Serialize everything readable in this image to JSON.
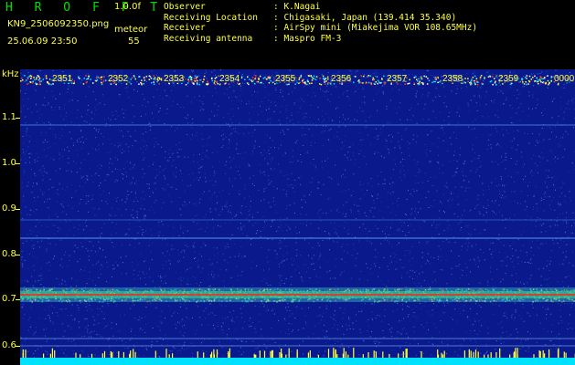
{
  "header": {
    "app_title": "H R O F F T",
    "version": "1.0.0f",
    "filename": "KN9_2506092350.png",
    "meteor_label": "meteor",
    "datetime": "25.06.09 23:50",
    "meteor_count": "55",
    "info": [
      {
        "key": "Observer",
        "value": ": K.Nagai"
      },
      {
        "key": "Receiving Location",
        "value": ": Chigasaki, Japan (139.414 35.340)"
      },
      {
        "key": "Receiver",
        "value": ": AirSpy mini (Miakejima VOR 108.65MHz)"
      },
      {
        "key": "Receiving antenna",
        "value": ": Maspro FM-3"
      }
    ]
  },
  "axis": {
    "unit": "kHz",
    "labels": [
      "1.1",
      "1.0",
      "0.9",
      "0.8",
      "0.7",
      "0.6"
    ]
  },
  "time_markers": [
    "2351",
    "2352",
    "2353",
    "2354",
    "2355",
    "2356",
    "2357",
    "2358",
    "2359",
    "0000"
  ],
  "colors": {
    "label": "#ffff40",
    "title": "#00e000",
    "background": "#0a1a8c",
    "noise": "#3060d0",
    "signal": "#ff2020",
    "baseline": "#00e0ff"
  }
}
